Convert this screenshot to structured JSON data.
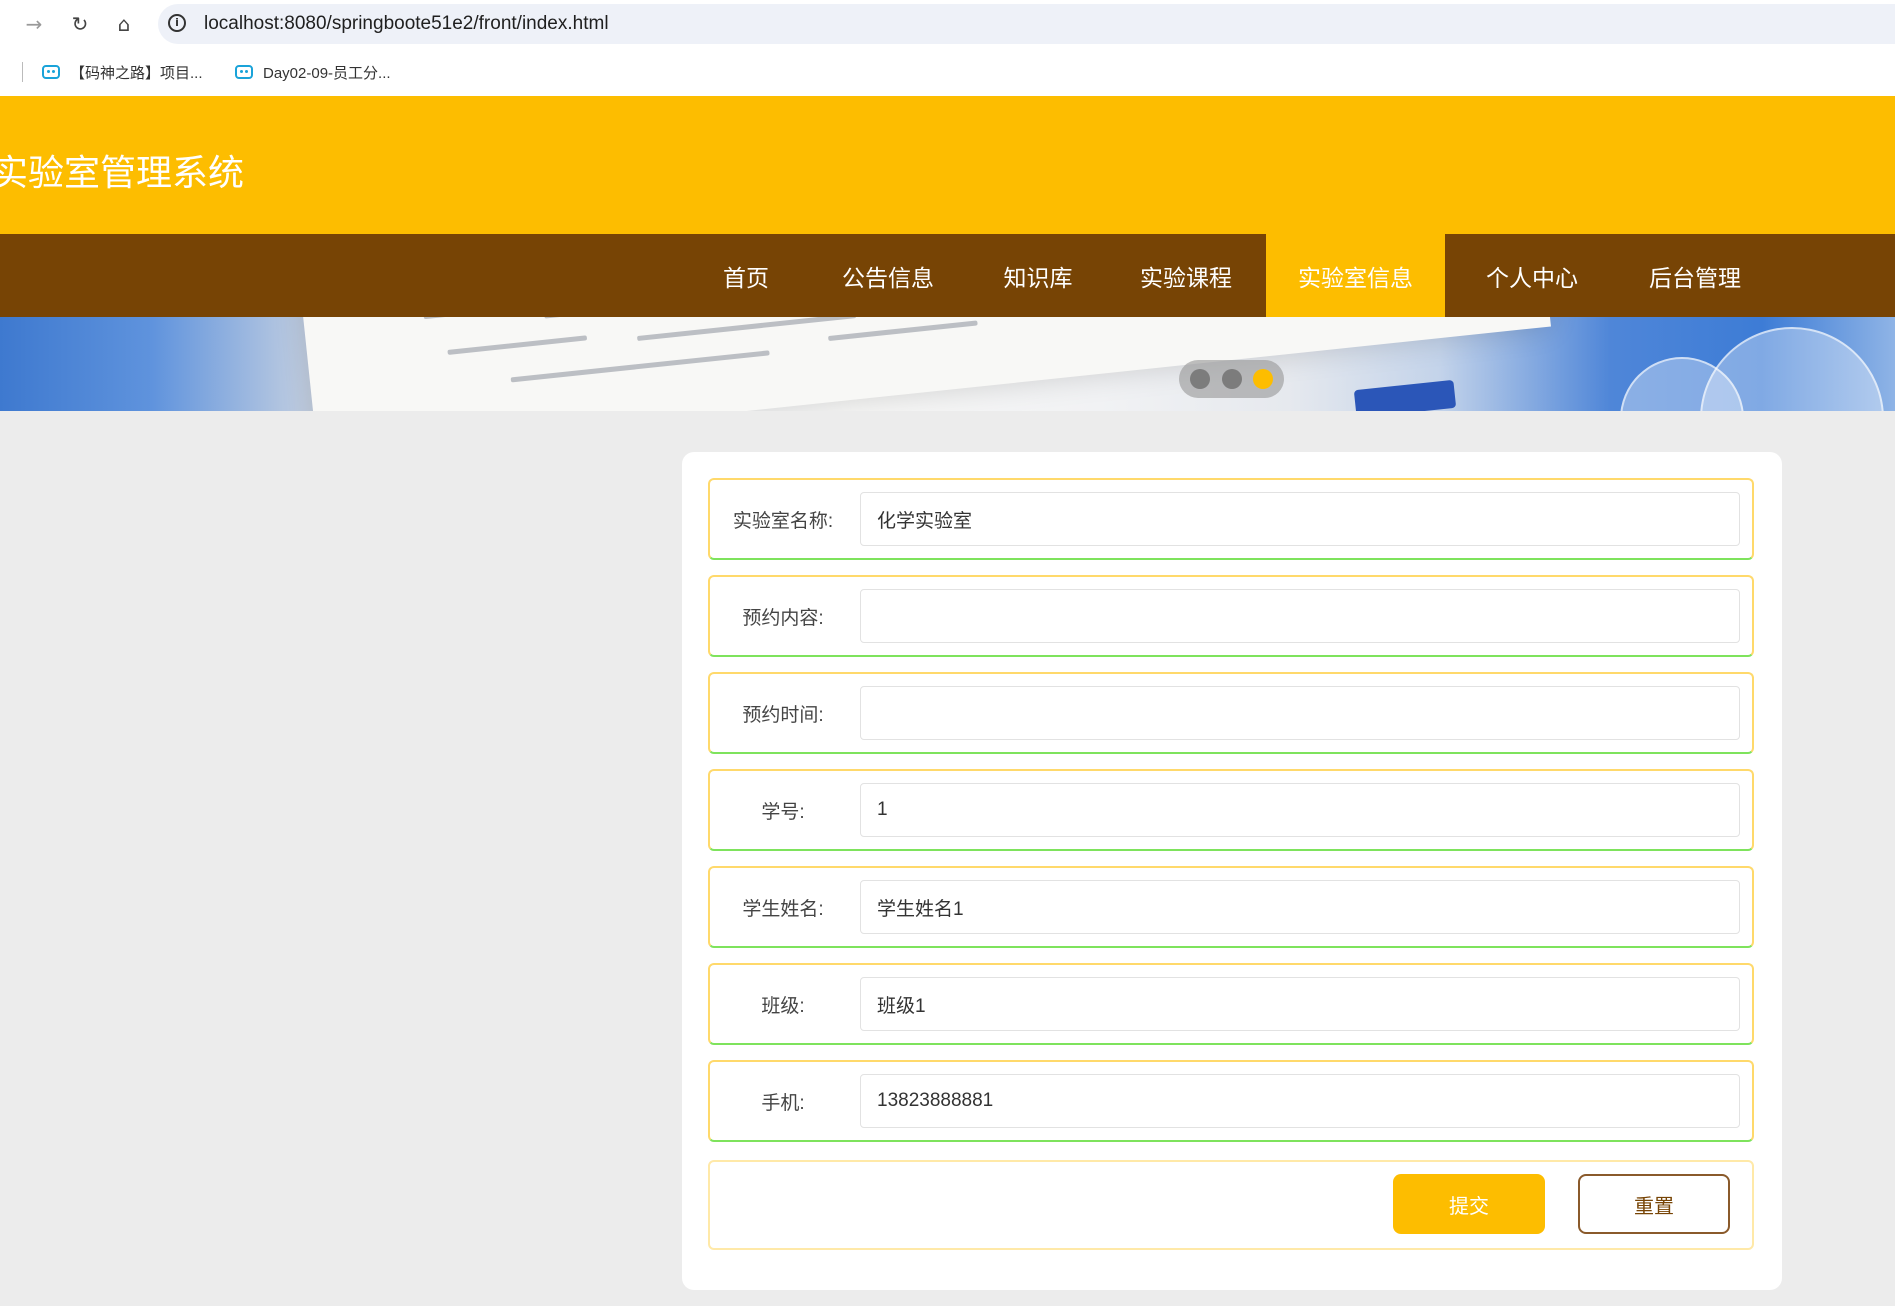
{
  "browser": {
    "url": "localhost:8080/springboote51e2/front/index.html",
    "bookmarks": [
      "【码神之路】项目...",
      "Day02-09-员工分..."
    ]
  },
  "site": {
    "title": "实验室管理系统"
  },
  "nav": {
    "items": [
      "首页",
      "公告信息",
      "知识库",
      "实验课程",
      "实验室信息",
      "个人中心",
      "后台管理"
    ],
    "active": "实验室信息"
  },
  "banner": {
    "slide_count": 3,
    "active_slide": 3
  },
  "form": {
    "fields": [
      {
        "label": "实验室名称:",
        "value": "化学实验室"
      },
      {
        "label": "预约内容:",
        "value": ""
      },
      {
        "label": "预约时间:",
        "value": ""
      },
      {
        "label": "学号:",
        "value": "1"
      },
      {
        "label": "学生姓名:",
        "value": "学生姓名1"
      },
      {
        "label": "班级:",
        "value": "班级1"
      },
      {
        "label": "手机:",
        "value": "13823888881"
      }
    ],
    "submit_label": "提交",
    "reset_label": "重置"
  },
  "colors": {
    "header": "#fdbd00",
    "nav": "#774405",
    "accent": "#fdbd00",
    "page_bg": "#ececec"
  }
}
